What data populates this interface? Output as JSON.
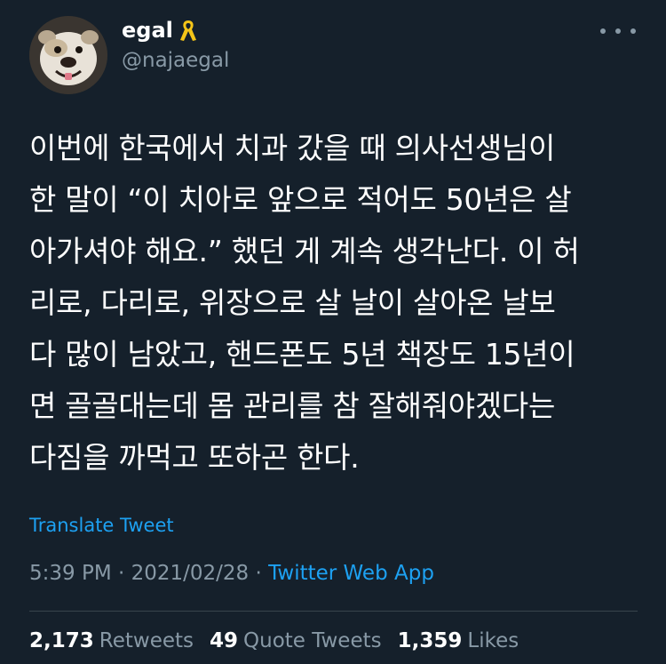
{
  "user": {
    "display_name": "egal",
    "handle": "@najaegal",
    "badge_icon": "yellow-ribbon-icon"
  },
  "tweet": {
    "text": "이번에 한국에서 치과 갔을 때 의사선생님이\n한 말이 “이 치아로 앞으로 적어도 50년은 살\n아가셔야 해요.” 했던 게 계속 생각난다. 이 허\n리로, 다리로, 위장으로 살 날이 살아온 날보\n다 많이 남았고, 핸드폰도 5년 책장도 15년이\n면 골골대는데 몸 관리를 참 잘해줘야겠다는\n다짐을 까먹고 또하곤 한다.",
    "translate_label": "Translate Tweet",
    "time": "5:39 PM",
    "separator": "·",
    "date": "2021/02/28",
    "source": "Twitter Web App"
  },
  "stats": [
    {
      "count": "2,173",
      "label": "Retweets"
    },
    {
      "count": "49",
      "label": "Quote Tweets"
    },
    {
      "count": "1,359",
      "label": "Likes"
    }
  ],
  "colors": {
    "background": "#15202b",
    "text": "#ffffff",
    "secondary": "#8899a6",
    "accent": "#1da1f2",
    "divider": "#38444d",
    "ribbon": "#f5c518"
  }
}
